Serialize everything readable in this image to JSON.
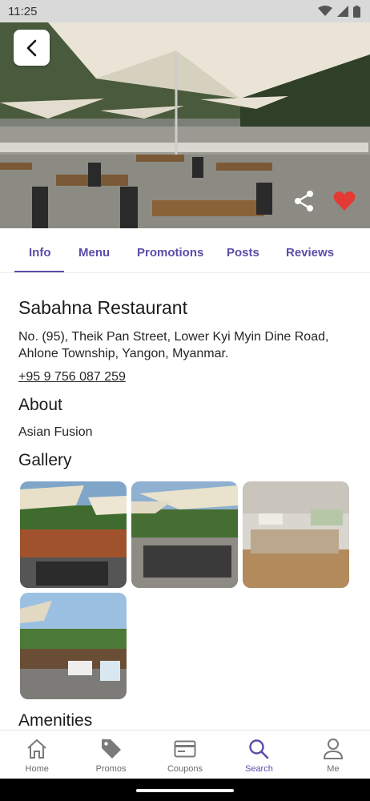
{
  "status_bar": {
    "time": "11:25"
  },
  "restaurant": {
    "name": "Sabahna Restaurant",
    "address": "No. (95), Theik Pan Street, Lower Kyi Myin Dine Road, Ahlone Township, Yangon, Myanmar.",
    "phone": "+95 9 756 087 259"
  },
  "tabs": [
    {
      "label": "Info",
      "active": true
    },
    {
      "label": "Menu"
    },
    {
      "label": "Promotions"
    },
    {
      "label": "Posts"
    },
    {
      "label": "Reviews"
    }
  ],
  "about": {
    "heading": "About",
    "text": "Asian Fusion"
  },
  "gallery": {
    "heading": "Gallery",
    "image_count": 4
  },
  "amenities": {
    "heading": "Amenities"
  },
  "favorited": true,
  "bottom_nav": [
    {
      "label": "Home",
      "icon": "home-icon"
    },
    {
      "label": "Promos",
      "icon": "tag-icon"
    },
    {
      "label": "Coupons",
      "icon": "card-icon"
    },
    {
      "label": "Search",
      "icon": "search-icon",
      "active": true
    },
    {
      "label": "Me",
      "icon": "person-icon"
    }
  ],
  "colors": {
    "accent": "#5a4ea8",
    "favorite": "#e53935"
  }
}
